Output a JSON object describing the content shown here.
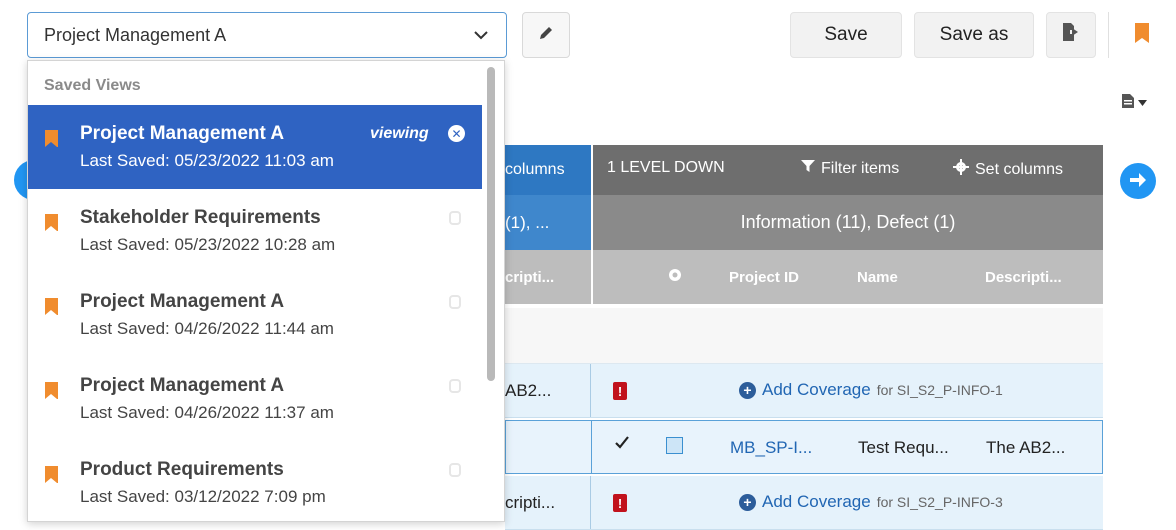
{
  "toolbar": {
    "selected_view": "Project Management A",
    "save_label": "Save",
    "save_as_label": "Save as"
  },
  "dropdown": {
    "section_label": "Saved Views",
    "items": [
      {
        "name": "Project Management A",
        "last_saved": "Last Saved: 05/23/2022 11:03 am",
        "status": "viewing",
        "active": true
      },
      {
        "name": "Stakeholder Requirements",
        "last_saved": "Last Saved: 05/23/2022 10:28 am"
      },
      {
        "name": "Project Management A",
        "last_saved": "Last Saved: 04/26/2022 11:44 am"
      },
      {
        "name": "Project Management A",
        "last_saved": "Last Saved: 04/26/2022 11:37 am"
      },
      {
        "name": "Product Requirements",
        "last_saved": "Last Saved: 03/12/2022 7:09 pm"
      }
    ]
  },
  "grid": {
    "left_header": "columns",
    "level_label": "1 LEVEL DOWN",
    "filter_label": "Filter items",
    "set_columns_label": "Set columns",
    "left_group": "(1), ...",
    "right_group": "Information (11), Defect (1)",
    "left_col": "cripti...",
    "col_project_id": "Project ID",
    "col_name": "Name",
    "col_description": "Descripti...",
    "rows": [
      {
        "left": "AB2...",
        "add_coverage": "Add Coverage",
        "for_text": "for SI_S2_P-INFO-1"
      },
      {
        "id": "MB_SP-I...",
        "name": "Test Requ...",
        "description": "The AB2..."
      },
      {
        "left": "cripti...",
        "add_coverage": "Add Coverage",
        "for_text": "for SI_S2_P-INFO-3"
      }
    ]
  },
  "colors": {
    "accent": "#2f63c2",
    "bookmark": "#f08c2e",
    "header_dark": "#6e6e6e",
    "defect_red": "#c1121c"
  }
}
